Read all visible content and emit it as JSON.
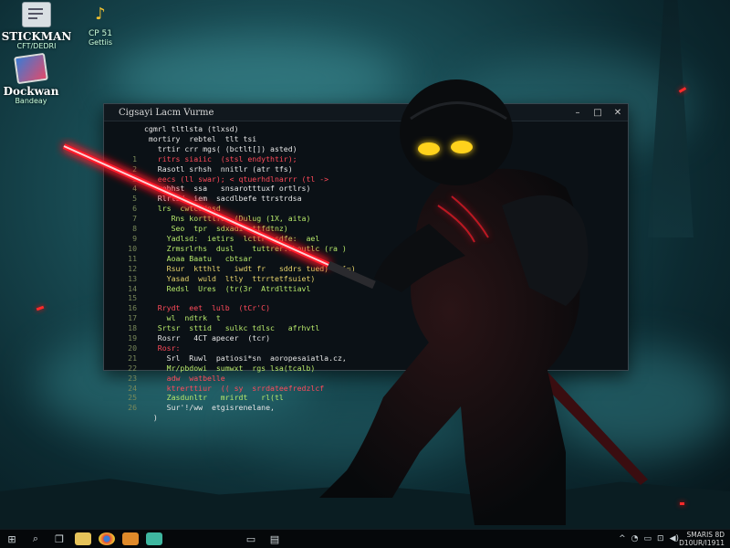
{
  "desktop": {
    "icons": [
      {
        "label": "STICKMAN",
        "sublabel": "CFT/DEDRI",
        "icon": "document-icon"
      },
      {
        "label": "CP 51",
        "sublabel": "Gettiis",
        "icon": "audio-file-icon"
      },
      {
        "label": "Dockwan",
        "sublabel": "Bandeay",
        "icon": "image-folder-icon"
      }
    ]
  },
  "window": {
    "title": "Cigsayi Lacm Vurme",
    "minimize": "–",
    "maximize": "□",
    "close": "✕",
    "code_lines": [
      {
        "num": "",
        "text": "cgmrl tltlsta (tlxsd)",
        "color": "w"
      },
      {
        "num": "",
        "text": " mortiry  rebtel  tlt tsi",
        "color": "w"
      },
      {
        "num": "",
        "text": "   trtir crr mgs( (bctlt[]) asted)",
        "color": "w"
      },
      {
        "num": "1",
        "text": "   ritrs siaiic  (stsl endythtir);",
        "color": "r"
      },
      {
        "num": "2",
        "text": "   Rasotl srhsh  nnitlr (atr tfs)",
        "color": "w"
      },
      {
        "num": "3",
        "text": "   eecs (ll swar); < qtuerhdlnarrr (tl ->",
        "color": "r"
      },
      {
        "num": "4",
        "text": "   wobhst  ssa   snsarotttuxf ortlrs)",
        "color": "w"
      },
      {
        "num": "5",
        "text": "   Rlrlsd  iem  sacdlbefe ttrstrdsa",
        "color": "w"
      },
      {
        "num": "6",
        "text": "   lrs  cwtcodnsd",
        "color": "g"
      },
      {
        "num": "7",
        "text": "      Rns korttlfe  (Dulug (1X, aita)",
        "color": "g"
      },
      {
        "num": "8",
        "text": "      Seo  tpr  sdxadi uttfdtnz)",
        "color": "g"
      },
      {
        "num": "9",
        "text": "     Yadlsd:  ietirs  lcttr  sdfe:  ael",
        "color": "g"
      },
      {
        "num": "10",
        "text": "     Zrmsrlrhs  dusl    tuttrer.Cboutlc (ra )",
        "color": "g"
      },
      {
        "num": "11",
        "text": "     Aoaa Baatu   cbtsar",
        "color": "g"
      },
      {
        "num": "12",
        "text": "     Rsur  ktthlt   iwdt fr   sddrs tued) ' [=)",
        "color": "y"
      },
      {
        "num": "13",
        "text": "     Yasad  wuld  ltly  ttrrtetfsuiet)",
        "color": "y"
      },
      {
        "num": "14",
        "text": "     Redsl  Ures  (tr(3r  Atrdlttiavl",
        "color": "g"
      },
      {
        "num": "15",
        "text": "",
        "color": "w"
      },
      {
        "num": "16",
        "text": "   Rrydt  eet  lulb  (tCr'C)",
        "color": "r"
      },
      {
        "num": "17",
        "text": "     wl  ndtrk  t",
        "color": "g"
      },
      {
        "num": "18",
        "text": "   Srtsr  sttid   sulkc tdlsc   afrhvtl",
        "color": "g"
      },
      {
        "num": "19",
        "text": "   Rosrr   4CT apecer  (tcr)",
        "color": "w"
      },
      {
        "num": "20",
        "text": "   Rosr:",
        "color": "r"
      },
      {
        "num": "21",
        "text": "     Srl  Ruwl  patiosi*sn  aoropesaiatla.cz,",
        "color": "w"
      },
      {
        "num": "22",
        "text": "     Mr/pbdowi  sumwxt  rgs lsa(tcalb)",
        "color": "g"
      },
      {
        "num": "23",
        "text": "     adw  watbelle",
        "color": "r"
      },
      {
        "num": "24",
        "text": "     ktrerttiur  (( sy  srrdateefredzlcf",
        "color": "r"
      },
      {
        "num": "25",
        "text": "     Zasdunltr   mrirdt   rl(tl",
        "color": "g"
      },
      {
        "num": "26",
        "text": "     Sur'!/ww  etgisrenelane,",
        "color": "w"
      },
      {
        "num": "",
        "text": "  )",
        "color": "w"
      }
    ]
  },
  "taskbar": {
    "start": "⊞",
    "apps": [
      {
        "name": "search",
        "icon": "search-icon",
        "color": "#cfd7db"
      },
      {
        "name": "task-view",
        "icon": "task-view-icon",
        "color": "#cfd7db"
      },
      {
        "name": "explorer",
        "icon": "folder-icon",
        "color": "#e6c35a"
      },
      {
        "name": "chrome",
        "icon": "chrome-icon",
        "color": "#e24a3a"
      },
      {
        "name": "app-orange",
        "icon": "app-icon",
        "color": "#e08a2a"
      },
      {
        "name": "app-teal",
        "icon": "app-icon",
        "color": "#3fb7a0"
      }
    ],
    "clock_time": "SMARIS 8D",
    "clock_date": "D10UR/I1911",
    "tray_glyphs": [
      "^",
      "◔",
      "▭",
      "⊡",
      "◀)"
    ]
  },
  "colors": {
    "saber": "#ff1a2a",
    "eyes": "#ffd21a",
    "code_green": "#b6e86a",
    "code_red": "#ff4a5a"
  }
}
